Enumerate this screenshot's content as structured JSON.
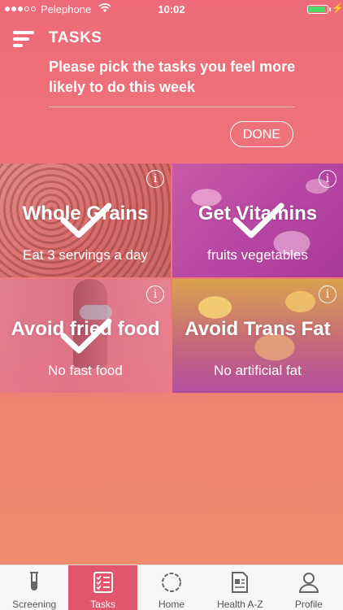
{
  "status_bar": {
    "carrier": "Pelephone",
    "time": "10:02",
    "battery_level": 0.9
  },
  "header": {
    "title": "TASKS",
    "prompt": "Please pick the tasks you feel more likely to do this week",
    "done_label": "DONE"
  },
  "tasks": [
    {
      "title": "Whole Grains",
      "subtitle": "Eat 3 servings a day",
      "selected": true
    },
    {
      "title": "Get Vitamins",
      "subtitle": "fruits vegetables",
      "selected": true
    },
    {
      "title": "Avoid fried food",
      "subtitle": "No fast food",
      "selected": true
    },
    {
      "title": "Avoid Trans Fat",
      "subtitle": "No artificial fat",
      "selected": false
    }
  ],
  "info_symbol": "i",
  "tab_bar": {
    "active": "Tasks",
    "items": [
      {
        "label": "Screening",
        "icon": "test-tube-icon"
      },
      {
        "label": "Tasks",
        "icon": "checklist-icon"
      },
      {
        "label": "Home",
        "icon": "home-circle-icon"
      },
      {
        "label": "Health A-Z",
        "icon": "document-icon"
      },
      {
        "label": "Profile",
        "icon": "person-icon"
      }
    ]
  },
  "colors": {
    "accent": "#e0566d",
    "header_bg": "#ee6a7a",
    "battery": "#4cd964"
  }
}
